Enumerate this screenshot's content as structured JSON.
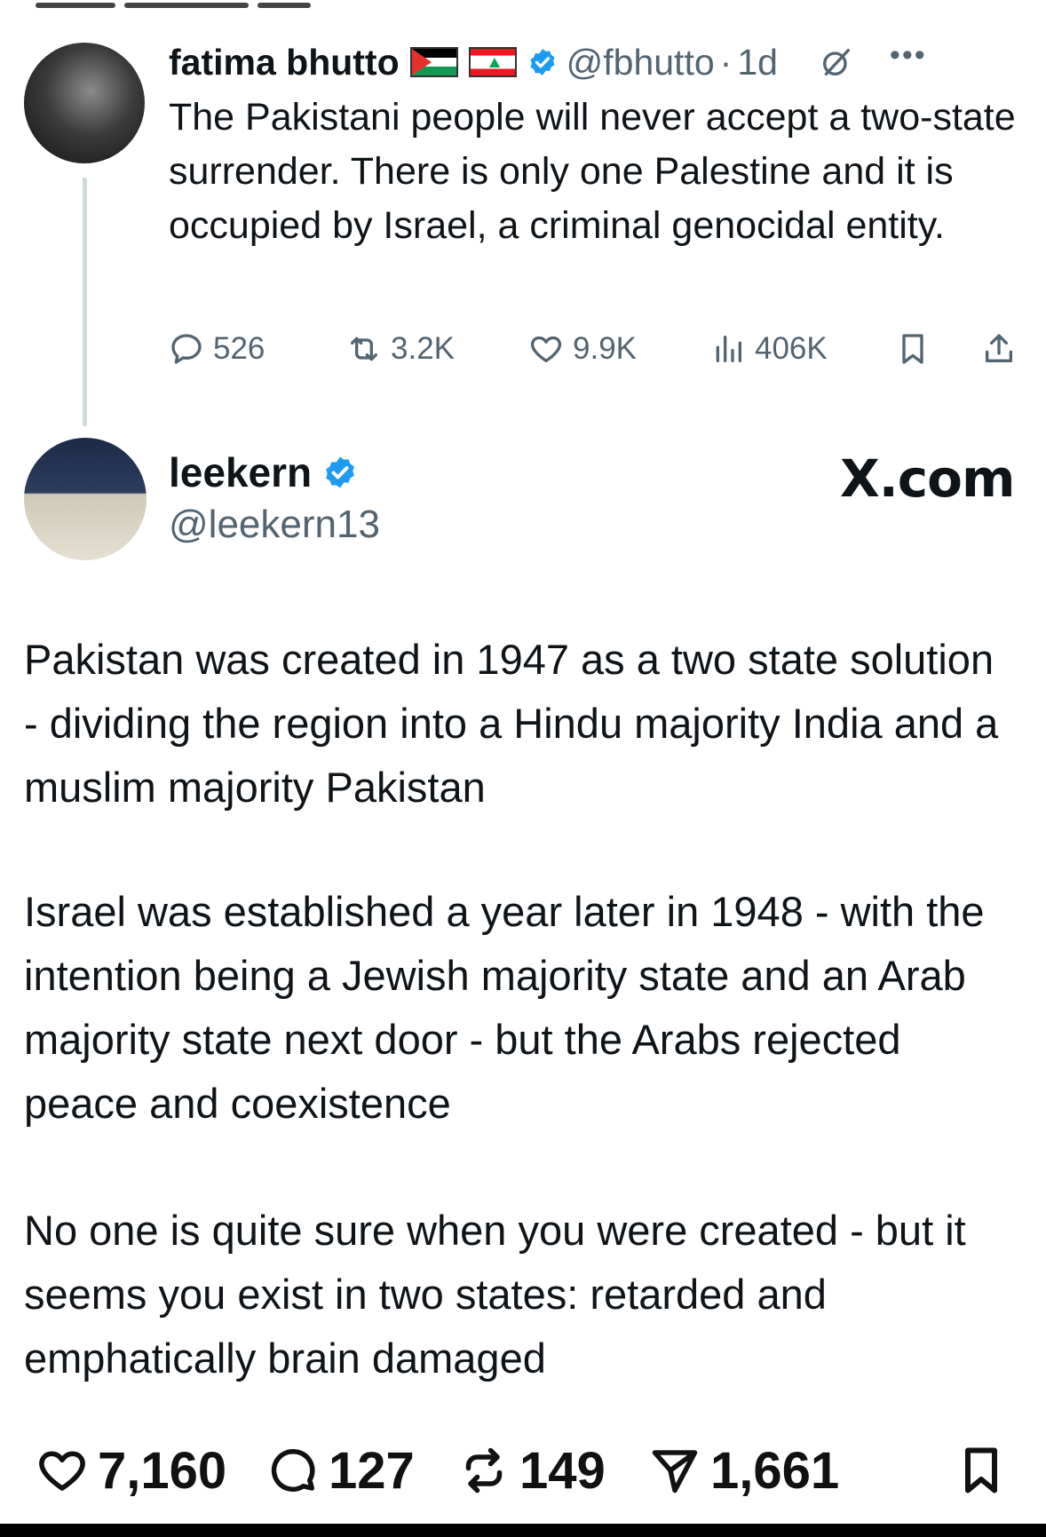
{
  "parent_tweet": {
    "author_name": "fatima bhutto",
    "flags": [
      "palestine-flag",
      "lebanon-flag"
    ],
    "handle": "@fbhutto",
    "separator": "·",
    "time": "1d",
    "text": "The Pakistani people will never accept a two-state surrender. There is only one Palestine and it is occupied by Israel, a criminal genocidal entity.",
    "stats": {
      "replies": "526",
      "reposts": "3.2K",
      "likes": "9.9K",
      "views": "406K"
    }
  },
  "reply_tweet": {
    "author_name": "leekern",
    "handle": "@leekern13",
    "site_label": "X.com",
    "paragraphs": [
      "Pakistan was created in 1947 as a two state solution - dividing the region into a Hindu majority India and a muslim majority Pakistan",
      "Israel was established a year later in 1948 - with the intention being a Jewish majority state and an Arab majority state next door - but the Arabs rejected peace and coexistence",
      "No one is quite sure when you were created - but it seems you exist in two states: retarded and emphatically brain damaged"
    ],
    "stats": {
      "likes": "7,160",
      "replies": "127",
      "reposts": "149",
      "shares": "1,661"
    }
  },
  "colors": {
    "text": "#0f1419",
    "secondary": "#536471",
    "verified": "#1d9bf0",
    "thread_line": "#cfd9de"
  }
}
